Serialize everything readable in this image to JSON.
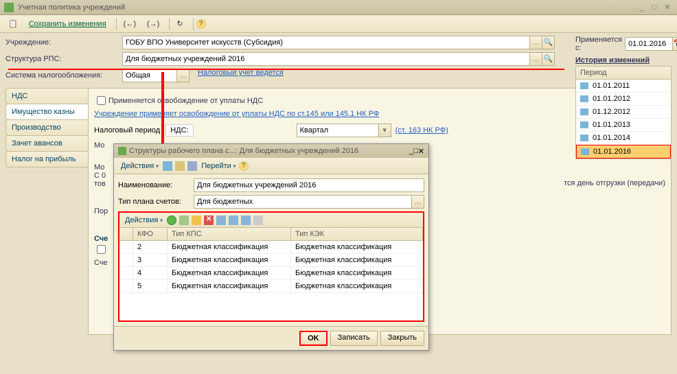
{
  "window": {
    "title": "Учетная политика учреждений",
    "save_btn": "Сохранить изменения"
  },
  "form": {
    "org_label": "Учреждение:",
    "org_value": "ГОБУ ВПО Университет искусств (Субсидия)",
    "rps_label": "Структура РПС:",
    "rps_value": "Для бюджетных учреждений 2016",
    "tax_sys_label": "Система налогообложения:",
    "tax_sys_value": "Общая",
    "tax_link": "Налоговый учет ведется",
    "applies_label": "Применяется с:",
    "applies_value": "01.01.2016"
  },
  "history": {
    "header": "История изменений",
    "col": "Период",
    "rows": [
      "01.01.2011",
      "01.01.2012",
      "01.12.2012",
      "01.01.2013",
      "01.01.2014",
      "01.01.2016"
    ]
  },
  "tabs": {
    "nds": "НДС",
    "property": "Имущество казны",
    "production": "Производство",
    "advances": "Зачет авансов",
    "profit_tax": "Налог на прибыль"
  },
  "nds_panel": {
    "chk_exempt": "Применяется освобождение от уплаты НДС",
    "exempt_link": "Учреждение применяет освобождение от уплаты НДС по ст.145 или 145.1 НК РФ",
    "tax_period_label": "Налоговый период",
    "tax_period_nds": "НДС:",
    "tax_period_value": "Квартал",
    "art163": "(ст. 163 НК РФ)",
    "mo_prefix": "Мо",
    "mo_suffix_1": "Мо",
    "mo_suffix_2": "С 0",
    "mo_suffix_3": "тов",
    "shipment_text": "тся день отгрузки (передачи)",
    "por_label": "Пор",
    "sch_label": "Сче",
    "sch_checkbox": "",
    "sch2_label": "Сче"
  },
  "dialog": {
    "title": "Структуры рабочего плана с...: Для бюджетных учреждений 2016",
    "actions": "Действия",
    "goto": "Перейти",
    "name_label": "Наименование:",
    "name_value": "Для бюджетных учреждений 2016",
    "plan_type_label": "Тип плана счетов:",
    "plan_type_value": "Для бюджетных",
    "cols": {
      "kfo": "КФО",
      "kps": "Тип КПС",
      "kek": "Тип КЭК"
    },
    "rows": [
      {
        "kfo": "2",
        "kps": "Бюджетная классификация",
        "kek": "Бюджетная классификация"
      },
      {
        "kfo": "3",
        "kps": "Бюджетная классификация",
        "kek": "Бюджетная классификация"
      },
      {
        "kfo": "4",
        "kps": "Бюджетная классификация",
        "kek": "Бюджетная классификация"
      },
      {
        "kfo": "5",
        "kps": "Бюджетная классификация",
        "kek": "Бюджетная классификация"
      }
    ],
    "ok": "OK",
    "save": "Записать",
    "close": "Закрыть"
  }
}
